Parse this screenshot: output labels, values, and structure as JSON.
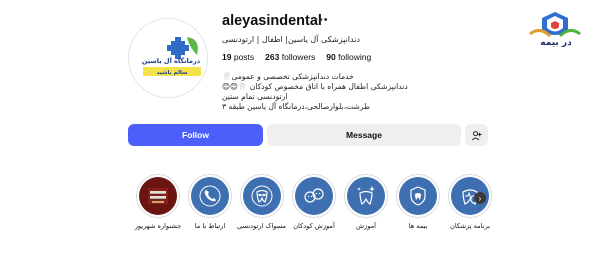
{
  "watermark": {
    "text": "در بیمه"
  },
  "profile": {
    "username": "aleyasindental",
    "full_name": "دندانپزشکی آل یاسین| اطفال | ارتودنسی",
    "avatar_logo_line1": "درمانگاه آل یاسین",
    "avatar_logo_line2": "سالم باشید"
  },
  "stats": {
    "posts_count": "19",
    "posts_label": "posts",
    "followers_count": "263",
    "followers_label": "followers",
    "following_count": "90",
    "following_label": "following"
  },
  "bio": {
    "line1": "خدمات دندانپزشکی تخصصی و عمومی🦷",
    "line2": "دندانپزشکی اطفال همراه با اتاق مخصوص کودکان 🦷😊😊",
    "line3": "ارتودنسی تمام ستین",
    "line4": "طرشت،بلوارصالحی،درمانگاه آل یاسین طبقه ۳"
  },
  "actions": {
    "follow_label": "Follow",
    "message_label": "Message"
  },
  "highlights": [
    {
      "label": "جشنواره شهریور",
      "icon": "festival-photo-icon",
      "bg": "#6b1512"
    },
    {
      "label": "ارتباط با ما",
      "icon": "phone-icon",
      "bg": "#3e6fb0"
    },
    {
      "label": "مسواک ارتودنسی",
      "icon": "braces-tooth-icon",
      "bg": "#3e6fb0"
    },
    {
      "label": "آموزش کودکان",
      "icon": "kids-faces-icon",
      "bg": "#3e6fb0"
    },
    {
      "label": "آموزش",
      "icon": "sparkle-tooth-icon",
      "bg": "#3e6fb0"
    },
    {
      "label": "بیمه ها",
      "icon": "insurance-shield-icon",
      "bg": "#3e6fb0"
    },
    {
      "label": "برنامه پزشکان",
      "icon": "tooth-pulse-icon",
      "bg": "#3e6fb0"
    }
  ],
  "colors": {
    "follow_button": "#4c5ffb",
    "secondary_button": "#efefef",
    "highlight_blue": "#3e6fb0"
  }
}
